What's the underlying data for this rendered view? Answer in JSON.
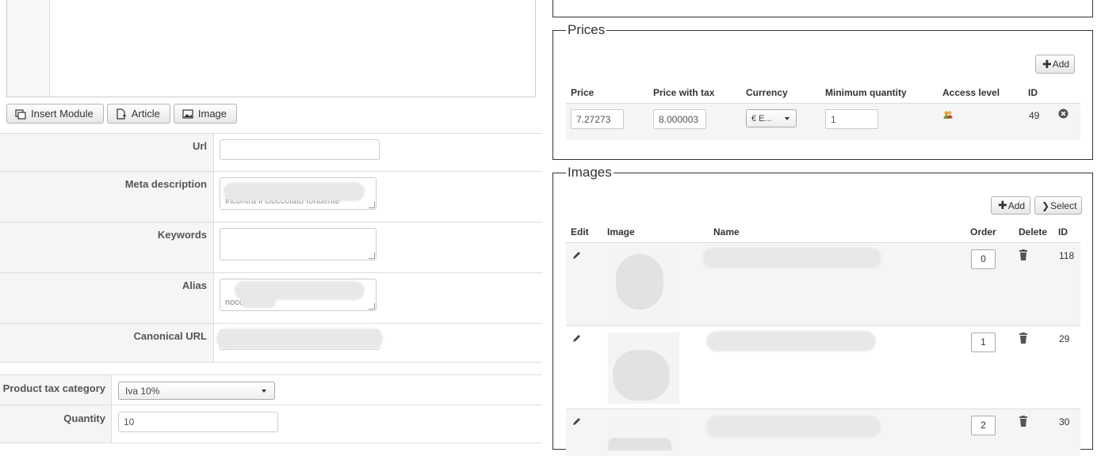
{
  "editor": {
    "buttons": {
      "insert_module": "Insert Module",
      "article": "Article",
      "image": "Image"
    }
  },
  "meta": {
    "url_label": "Url",
    "url_value": "",
    "meta_description_label": "Meta description",
    "meta_description_value": "incontra il cioccolato fondente",
    "keywords_label": "Keywords",
    "keywords_value": "",
    "alias_label": "Alias",
    "alias_value": "nocciole",
    "canonical_url_label": "Canonical URL",
    "canonical_url_value": ""
  },
  "product": {
    "tax_category_label": "Product tax category",
    "tax_category_value": "Iva 10%",
    "quantity_label": "Quantity",
    "quantity_value": "10"
  },
  "prices": {
    "legend": "Prices",
    "add_label": "Add",
    "columns": [
      "Price",
      "Price with tax",
      "Currency",
      "Minimum quantity",
      "Access level",
      "ID"
    ],
    "rows": [
      {
        "price": "7.27273",
        "price_with_tax": "8.000003",
        "currency": "€ E...",
        "min_quantity": "1",
        "id": "49"
      }
    ]
  },
  "images": {
    "legend": "Images",
    "add_label": "Add",
    "select_label": "Select",
    "columns": [
      "Edit",
      "Image",
      "Name",
      "Order",
      "Delete",
      "ID"
    ],
    "rows": [
      {
        "order": "0",
        "id": "118"
      },
      {
        "order": "1",
        "id": "29"
      },
      {
        "order": "2",
        "id": "30"
      }
    ]
  },
  "colors": {
    "row_bg": "#f5f5f5",
    "border": "#dddddd",
    "panel_border": "#333333"
  }
}
